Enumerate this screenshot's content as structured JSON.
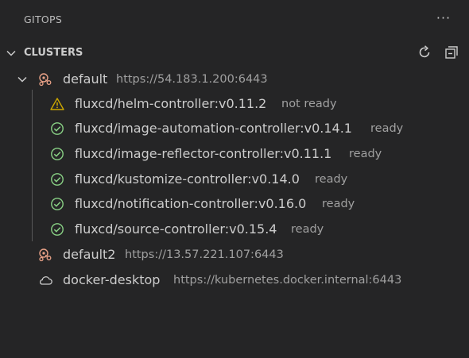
{
  "panel": {
    "title": "GITOPS",
    "more_label": "···"
  },
  "section": {
    "title": "CLUSTERS"
  },
  "clusters": [
    {
      "name": "default",
      "url": "https://54.183.1.200:6443",
      "icon": "cluster-icon",
      "expanded": true,
      "controllers": [
        {
          "name": "fluxcd/helm-controller:v0.11.2",
          "status": "not ready",
          "icon": "warning-icon"
        },
        {
          "name": "fluxcd/image-automation-controller:v0.14.1",
          "status": "ready",
          "icon": "check-circle-icon"
        },
        {
          "name": "fluxcd/image-reflector-controller:v0.11.1",
          "status": "ready",
          "icon": "check-circle-icon"
        },
        {
          "name": "fluxcd/kustomize-controller:v0.14.0",
          "status": "ready",
          "icon": "check-circle-icon"
        },
        {
          "name": "fluxcd/notification-controller:v0.16.0",
          "status": "ready",
          "icon": "check-circle-icon"
        },
        {
          "name": "fluxcd/source-controller:v0.15.4",
          "status": "ready",
          "icon": "check-circle-icon"
        }
      ]
    },
    {
      "name": "default2",
      "url": "https://13.57.221.107:6443",
      "icon": "cluster-icon",
      "expanded": false
    },
    {
      "name": "docker-desktop",
      "url": "https://kubernetes.docker.internal:6443",
      "icon": "cloud-icon",
      "expanded": false
    }
  ],
  "colors": {
    "background": "#252526",
    "warning": "#cca700",
    "ok": "#89d185",
    "cluster": "#e8a187"
  }
}
